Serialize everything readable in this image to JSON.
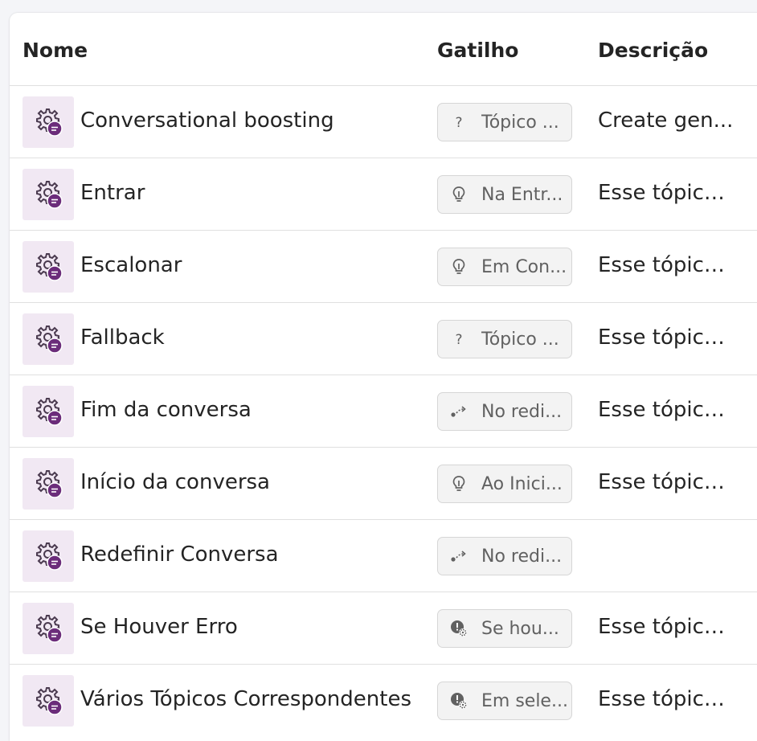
{
  "table": {
    "columns": {
      "name": "Nome",
      "trigger": "Gatilho",
      "description": "Descrição"
    },
    "rows": [
      {
        "name": "Conversational boosting",
        "trigger_icon": "question-icon",
        "trigger": "Tópico ...",
        "description": "Create gen..."
      },
      {
        "name": "Entrar",
        "trigger_icon": "lightbulb-icon",
        "trigger": "Na Entr...",
        "description": "Esse tópico ..."
      },
      {
        "name": "Escalonar",
        "trigger_icon": "lightbulb-icon",
        "trigger": "Em Con...",
        "description": "Esse tópico ..."
      },
      {
        "name": "Fallback",
        "trigger_icon": "question-icon",
        "trigger": "Tópico ...",
        "description": "Esse tópico ..."
      },
      {
        "name": "Fim da conversa",
        "trigger_icon": "redirect-icon",
        "trigger": "No redi...",
        "description": "Esse tópico ..."
      },
      {
        "name": "Início da conversa",
        "trigger_icon": "lightbulb-icon",
        "trigger": "Ao Inici...",
        "description": "Esse tópico ..."
      },
      {
        "name": "Redefinir Conversa",
        "trigger_icon": "redirect-icon",
        "trigger": "No redi...",
        "description": ""
      },
      {
        "name": "Se Houver Erro",
        "trigger_icon": "error-gear-icon",
        "trigger": "Se hou...",
        "description": "Esse tópico ..."
      },
      {
        "name": "Vários Tópicos Correspondentes",
        "trigger_icon": "error-gear-icon",
        "trigger": "Em sele...",
        "description": "Esse tópico ..."
      }
    ]
  },
  "colors": {
    "topic_icon_bg": "#f1e8f3",
    "topic_icon_accent": "#6b2c7a",
    "pill_bg": "#f3f3f3",
    "border": "#e0e0e0"
  }
}
